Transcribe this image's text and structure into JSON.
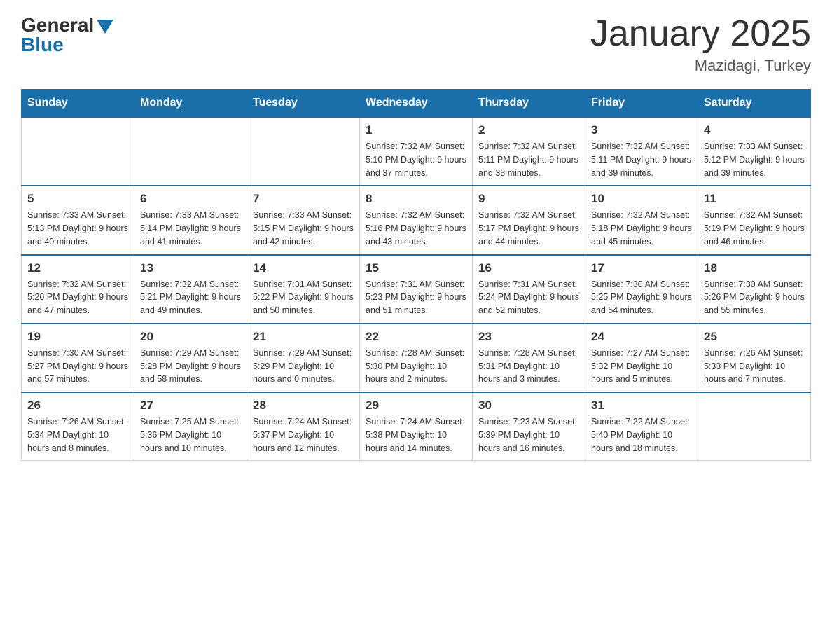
{
  "logo": {
    "general": "General",
    "blue": "Blue"
  },
  "title": "January 2025",
  "subtitle": "Mazidagi, Turkey",
  "days_of_week": [
    "Sunday",
    "Monday",
    "Tuesday",
    "Wednesday",
    "Thursday",
    "Friday",
    "Saturday"
  ],
  "weeks": [
    [
      {
        "day": "",
        "info": ""
      },
      {
        "day": "",
        "info": ""
      },
      {
        "day": "",
        "info": ""
      },
      {
        "day": "1",
        "info": "Sunrise: 7:32 AM\nSunset: 5:10 PM\nDaylight: 9 hours\nand 37 minutes."
      },
      {
        "day": "2",
        "info": "Sunrise: 7:32 AM\nSunset: 5:11 PM\nDaylight: 9 hours\nand 38 minutes."
      },
      {
        "day": "3",
        "info": "Sunrise: 7:32 AM\nSunset: 5:11 PM\nDaylight: 9 hours\nand 39 minutes."
      },
      {
        "day": "4",
        "info": "Sunrise: 7:33 AM\nSunset: 5:12 PM\nDaylight: 9 hours\nand 39 minutes."
      }
    ],
    [
      {
        "day": "5",
        "info": "Sunrise: 7:33 AM\nSunset: 5:13 PM\nDaylight: 9 hours\nand 40 minutes."
      },
      {
        "day": "6",
        "info": "Sunrise: 7:33 AM\nSunset: 5:14 PM\nDaylight: 9 hours\nand 41 minutes."
      },
      {
        "day": "7",
        "info": "Sunrise: 7:33 AM\nSunset: 5:15 PM\nDaylight: 9 hours\nand 42 minutes."
      },
      {
        "day": "8",
        "info": "Sunrise: 7:32 AM\nSunset: 5:16 PM\nDaylight: 9 hours\nand 43 minutes."
      },
      {
        "day": "9",
        "info": "Sunrise: 7:32 AM\nSunset: 5:17 PM\nDaylight: 9 hours\nand 44 minutes."
      },
      {
        "day": "10",
        "info": "Sunrise: 7:32 AM\nSunset: 5:18 PM\nDaylight: 9 hours\nand 45 minutes."
      },
      {
        "day": "11",
        "info": "Sunrise: 7:32 AM\nSunset: 5:19 PM\nDaylight: 9 hours\nand 46 minutes."
      }
    ],
    [
      {
        "day": "12",
        "info": "Sunrise: 7:32 AM\nSunset: 5:20 PM\nDaylight: 9 hours\nand 47 minutes."
      },
      {
        "day": "13",
        "info": "Sunrise: 7:32 AM\nSunset: 5:21 PM\nDaylight: 9 hours\nand 49 minutes."
      },
      {
        "day": "14",
        "info": "Sunrise: 7:31 AM\nSunset: 5:22 PM\nDaylight: 9 hours\nand 50 minutes."
      },
      {
        "day": "15",
        "info": "Sunrise: 7:31 AM\nSunset: 5:23 PM\nDaylight: 9 hours\nand 51 minutes."
      },
      {
        "day": "16",
        "info": "Sunrise: 7:31 AM\nSunset: 5:24 PM\nDaylight: 9 hours\nand 52 minutes."
      },
      {
        "day": "17",
        "info": "Sunrise: 7:30 AM\nSunset: 5:25 PM\nDaylight: 9 hours\nand 54 minutes."
      },
      {
        "day": "18",
        "info": "Sunrise: 7:30 AM\nSunset: 5:26 PM\nDaylight: 9 hours\nand 55 minutes."
      }
    ],
    [
      {
        "day": "19",
        "info": "Sunrise: 7:30 AM\nSunset: 5:27 PM\nDaylight: 9 hours\nand 57 minutes."
      },
      {
        "day": "20",
        "info": "Sunrise: 7:29 AM\nSunset: 5:28 PM\nDaylight: 9 hours\nand 58 minutes."
      },
      {
        "day": "21",
        "info": "Sunrise: 7:29 AM\nSunset: 5:29 PM\nDaylight: 10 hours\nand 0 minutes."
      },
      {
        "day": "22",
        "info": "Sunrise: 7:28 AM\nSunset: 5:30 PM\nDaylight: 10 hours\nand 2 minutes."
      },
      {
        "day": "23",
        "info": "Sunrise: 7:28 AM\nSunset: 5:31 PM\nDaylight: 10 hours\nand 3 minutes."
      },
      {
        "day": "24",
        "info": "Sunrise: 7:27 AM\nSunset: 5:32 PM\nDaylight: 10 hours\nand 5 minutes."
      },
      {
        "day": "25",
        "info": "Sunrise: 7:26 AM\nSunset: 5:33 PM\nDaylight: 10 hours\nand 7 minutes."
      }
    ],
    [
      {
        "day": "26",
        "info": "Sunrise: 7:26 AM\nSunset: 5:34 PM\nDaylight: 10 hours\nand 8 minutes."
      },
      {
        "day": "27",
        "info": "Sunrise: 7:25 AM\nSunset: 5:36 PM\nDaylight: 10 hours\nand 10 minutes."
      },
      {
        "day": "28",
        "info": "Sunrise: 7:24 AM\nSunset: 5:37 PM\nDaylight: 10 hours\nand 12 minutes."
      },
      {
        "day": "29",
        "info": "Sunrise: 7:24 AM\nSunset: 5:38 PM\nDaylight: 10 hours\nand 14 minutes."
      },
      {
        "day": "30",
        "info": "Sunrise: 7:23 AM\nSunset: 5:39 PM\nDaylight: 10 hours\nand 16 minutes."
      },
      {
        "day": "31",
        "info": "Sunrise: 7:22 AM\nSunset: 5:40 PM\nDaylight: 10 hours\nand 18 minutes."
      },
      {
        "day": "",
        "info": ""
      }
    ]
  ]
}
